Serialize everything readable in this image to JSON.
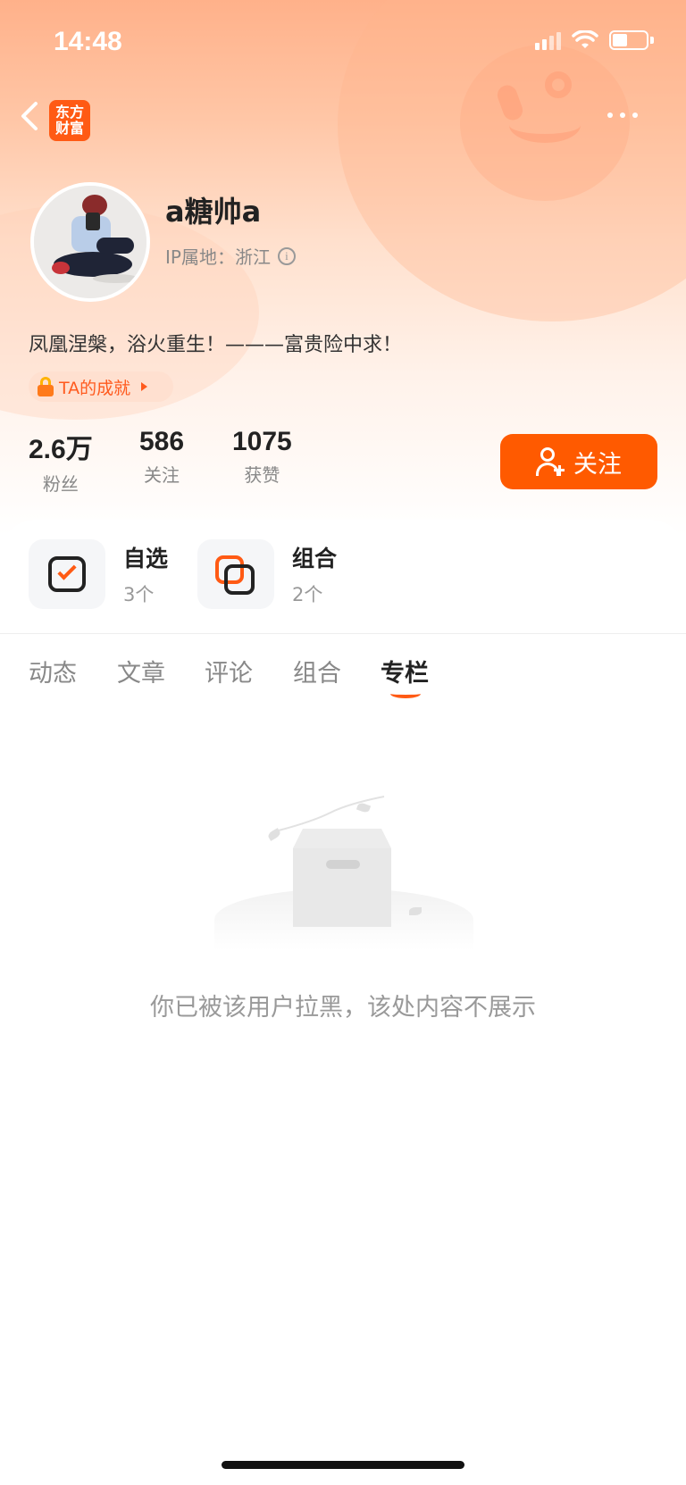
{
  "status_bar": {
    "time": "14:48"
  },
  "header": {
    "logo_line1": "东方",
    "logo_line2": "财富"
  },
  "profile": {
    "username": "a糖帅a",
    "ip_location": "IP属地：浙江",
    "bio": "凤凰涅槃，浴火重生！———富贵险中求！",
    "achievement_label": "TA的成就"
  },
  "stats": [
    {
      "value": "2.6万",
      "label": "粉丝"
    },
    {
      "value": "586",
      "label": "关注"
    },
    {
      "value": "1075",
      "label": "获赞"
    }
  ],
  "follow_button": {
    "label": "关注"
  },
  "quick_entries": [
    {
      "title": "自选",
      "sub": "3个",
      "icon": "watchlist-check-icon"
    },
    {
      "title": "组合",
      "sub": "2个",
      "icon": "portfolio-squares-icon"
    }
  ],
  "tabs": [
    {
      "label": "动态",
      "active": false
    },
    {
      "label": "文章",
      "active": false
    },
    {
      "label": "评论",
      "active": false
    },
    {
      "label": "组合",
      "active": false
    },
    {
      "label": "专栏",
      "active": true
    }
  ],
  "empty_state": {
    "message": "你已被该用户拉黑，该处内容不展示"
  },
  "colors": {
    "accent": "#ff5a00",
    "brand": "#ff5a14"
  }
}
